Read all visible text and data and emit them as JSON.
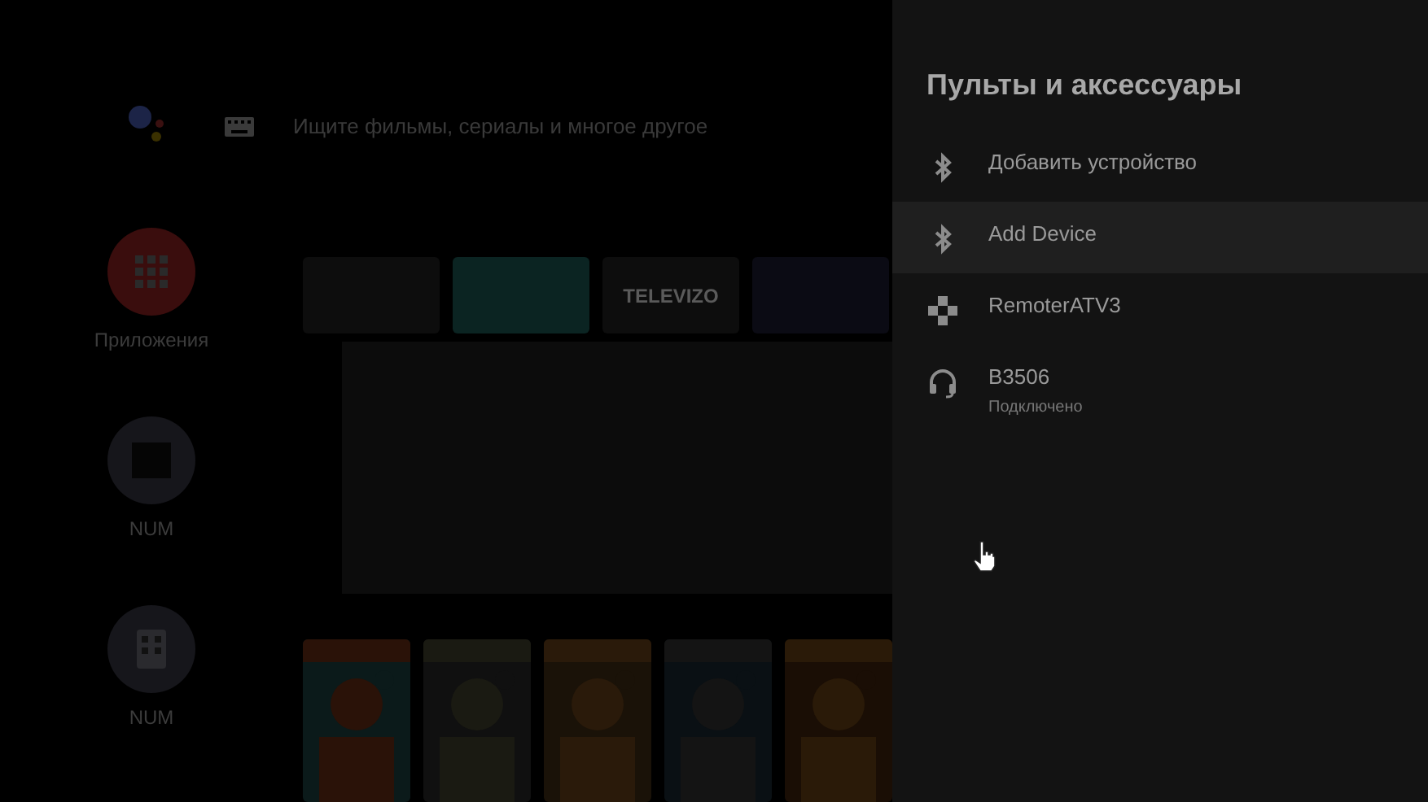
{
  "search": {
    "placeholder": "Ищите фильмы, сериалы и многое другое"
  },
  "nav": [
    {
      "label": "Приложения",
      "kind": "apps"
    },
    {
      "label": "NUM",
      "kind": "tv"
    },
    {
      "label": "NUM",
      "kind": "remote"
    }
  ],
  "app_tiles": [
    {
      "label": "TELEVIZO",
      "kind": "text"
    }
  ],
  "panel": {
    "title": "Пульты и аксессуары",
    "items": [
      {
        "label": "Добавить устройство",
        "kind": "bluetooth",
        "selected": false
      },
      {
        "label": "Add Device",
        "kind": "bluetooth",
        "selected": true
      },
      {
        "label": "RemoterATV3",
        "kind": "gamepad",
        "selected": false
      },
      {
        "label": "B3506",
        "sublabel": "Подключено",
        "kind": "headset",
        "selected": false
      }
    ]
  }
}
